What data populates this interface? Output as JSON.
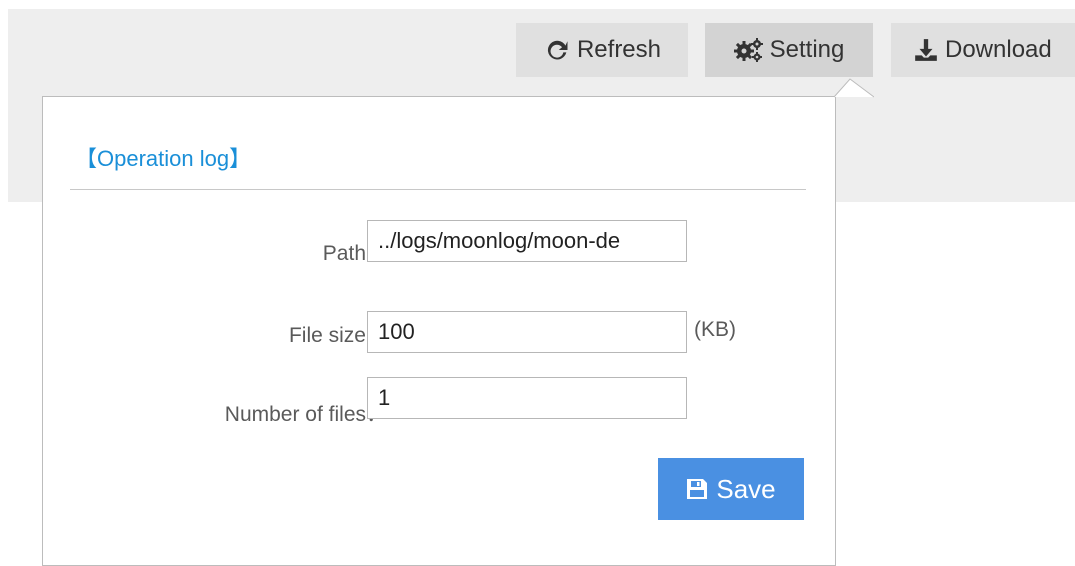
{
  "toolbar": {
    "refresh": {
      "label": "Refresh",
      "icon": "refresh-icon"
    },
    "setting": {
      "label": "Setting",
      "icon": "gears-icon"
    },
    "download": {
      "label": "Download",
      "icon": "download-icon"
    }
  },
  "panel": {
    "title": "【Operation log】",
    "fields": {
      "path": {
        "label": "Path：",
        "value": "../logs/moonlog/moon-de"
      },
      "file_size": {
        "label": "File size：",
        "value": "100",
        "unit": "(KB)"
      },
      "num_files": {
        "label": "Number of files：",
        "value": "1"
      }
    },
    "save": {
      "label": "Save",
      "icon": "floppy-disk-icon"
    }
  },
  "colors": {
    "accent": "#4a90e2",
    "title_blue": "#1a8fd8",
    "toolbar_bg": "#eeeeee",
    "button_bg": "#e0e0e0"
  }
}
